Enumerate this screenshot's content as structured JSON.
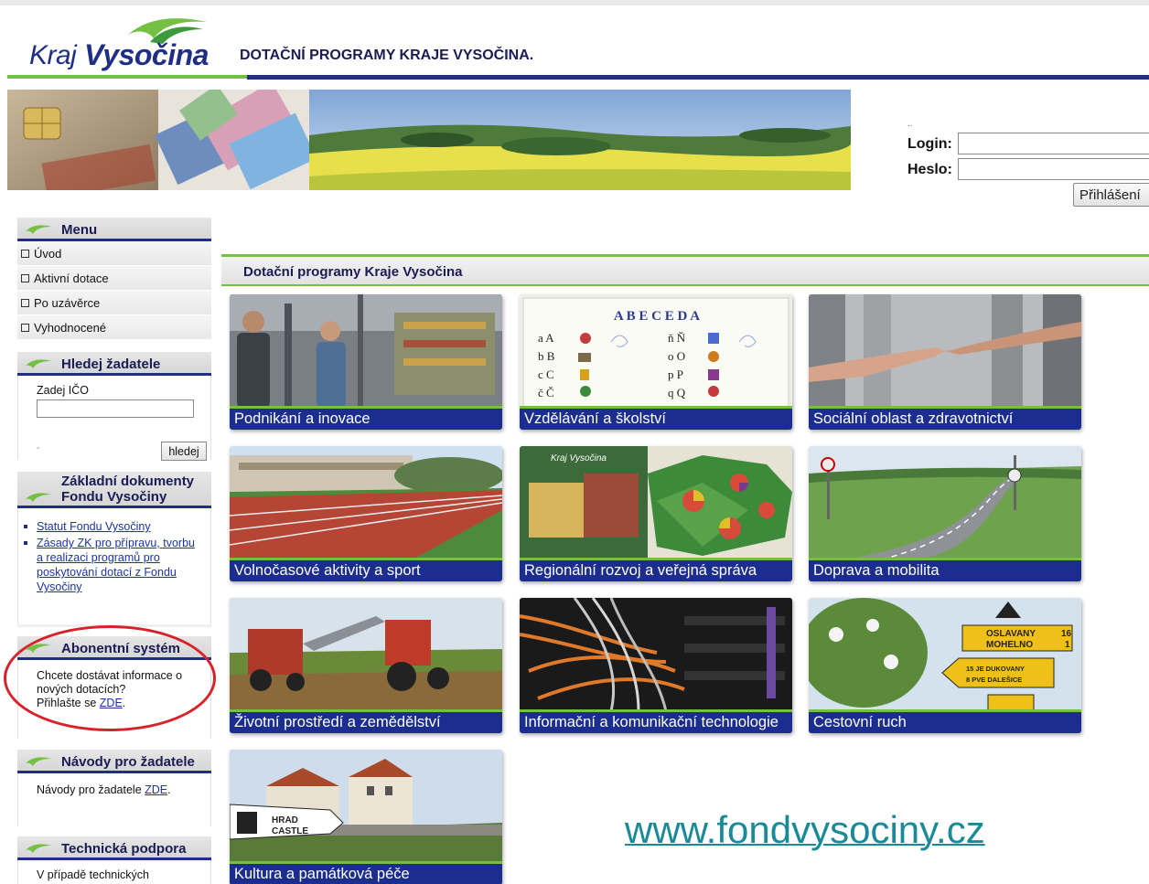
{
  "header": {
    "logo_kraj": "Kraj",
    "logo_vysocina": "Vysočina",
    "site_title": "DOTAČNÍ PROGRAMY KRAJE VYSOČINA."
  },
  "login": {
    "dots": "..",
    "login_label": "Login:",
    "password_label": "Heslo:",
    "login_value": "",
    "password_value": "",
    "submit_label": "Přihlášení"
  },
  "sidebar": {
    "menu": {
      "title": "Menu",
      "items": [
        {
          "label": "Úvod"
        },
        {
          "label": "Aktivní dotace"
        },
        {
          "label": "Po uzávěrce"
        },
        {
          "label": "Vyhodnocené"
        }
      ]
    },
    "search": {
      "title": "Hledej žadatele",
      "field_label": "Zadej IČO",
      "value": "",
      "hint": "-",
      "button_label": "hledej"
    },
    "documents": {
      "title_line1": "Základní dokumenty",
      "title_line2": "Fondu Vysočiny",
      "links": [
        {
          "label": "Statut Fondu Vysočiny"
        },
        {
          "label": "Zásady ZK pro přípravu, tvorbu a realizaci programů pro poskytování dotací z Fondu Vysočiny"
        }
      ]
    },
    "subscription": {
      "title": "Abonentní systém",
      "text": "Chcete dostávat informace o nových dotacích?",
      "text2": "Přihlašte se ",
      "link": "ZDE",
      "suffix": "."
    },
    "guides": {
      "title": "Návody pro žadatele",
      "text": "Návody pro žadatele ",
      "link": "ZDE",
      "suffix": "."
    },
    "support": {
      "title": "Technická podpora",
      "text": "V případě technických"
    }
  },
  "content": {
    "heading": "Dotační programy Kraje Vysočina",
    "tiles": [
      {
        "label": "Podnikání a inovace"
      },
      {
        "label": "Vzdělávání a školství"
      },
      {
        "label": "Sociální oblast a zdravotnictví"
      },
      {
        "label": "Volnočasové aktivity a sport"
      },
      {
        "label": "Regionální rozvoj a veřejná správa"
      },
      {
        "label": "Doprava a mobilita"
      },
      {
        "label": "Životní prostředí a zemědělství"
      },
      {
        "label": "Informační a komunikační technologie"
      },
      {
        "label": "Cestovní ruch"
      },
      {
        "label": "Kultura a památková péče"
      }
    ],
    "tile_art": {
      "abeceda": "A B E C E D A",
      "abeceda_left": [
        "a  A",
        "b  B",
        "c  C",
        "č  Č"
      ],
      "abeceda_right": [
        "ň  Ň",
        "o  O",
        "p  P",
        "q  Q"
      ],
      "map_logo": "Kraj Vysočina",
      "sign_top": "OSLAVANY",
      "sign_top_num": "16",
      "sign_top2": "MOHELNO",
      "sign_top2_num": "1",
      "sign_left": "15  JE DUKOVANY",
      "sign_left2": "8  PVE DALEŠICE",
      "castle_sign": "HRAD",
      "castle_sign2": "CASTLE"
    },
    "website": "www.fondvysociny.cz"
  },
  "colors": {
    "navy": "#1f2f86",
    "caption_bg": "#1b2d8e",
    "green": "#74c044",
    "link": "#1c33a8",
    "website": "#1a8a96",
    "highlight_ring": "#d8232a"
  }
}
